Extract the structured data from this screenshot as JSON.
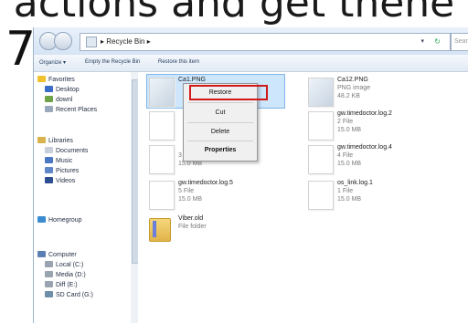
{
  "caption": "actions and get thene",
  "step_number": "7",
  "address_bar": {
    "path": "▸ Recycle Bin ▸",
    "search_placeholder": "Search"
  },
  "toolbar": {
    "organize": "Organize ▾",
    "empty": "Empty the Recycle Bin",
    "restore_all": "Restore this item"
  },
  "nav": {
    "favorites": "Favorites",
    "desktop": "Desktop",
    "downl": "downl",
    "recent": "Recent Places",
    "libraries": "Libraries",
    "documents": "Documents",
    "music": "Music",
    "pictures": "Pictures",
    "videos": "Videos",
    "homegroup": "Homegroup",
    "computer": "Computer",
    "local": "Local (C:)",
    "media": "Media (D:)",
    "diff": "Diff (E:)",
    "sdcard": "SD Card (G:)"
  },
  "files": [
    {
      "name": "Ca1.PNG",
      "sub1": "",
      "sub2": ""
    },
    {
      "name": "Ca12.PNG",
      "sub1": "PNG image",
      "sub2": "48.2 KB"
    },
    {
      "name": "",
      "sub1": "",
      "sub2": ""
    },
    {
      "name": "gw.timedoctor.log.2",
      "sub1": "2 File",
      "sub2": "15.0 MB"
    },
    {
      "name": "",
      "sub1": "3 File",
      "sub2": "15.0 MB"
    },
    {
      "name": "gw.timedoctor.log.4",
      "sub1": "4 File",
      "sub2": "15.0 MB"
    },
    {
      "name": "gw.timedoctor.log.5",
      "sub1": "5 File",
      "sub2": "15.0 MB"
    },
    {
      "name": "os_link.log.1",
      "sub1": "1 File",
      "sub2": "15.0 MB"
    },
    {
      "name": "Viber.old",
      "sub1": "File folder",
      "sub2": ""
    }
  ],
  "context_menu": {
    "restore": "Restore",
    "cut": "Cut",
    "delete": "Delete",
    "properties": "Properties"
  },
  "highlight_color": "#d01a1a",
  "selection_color": "#cde6fb"
}
